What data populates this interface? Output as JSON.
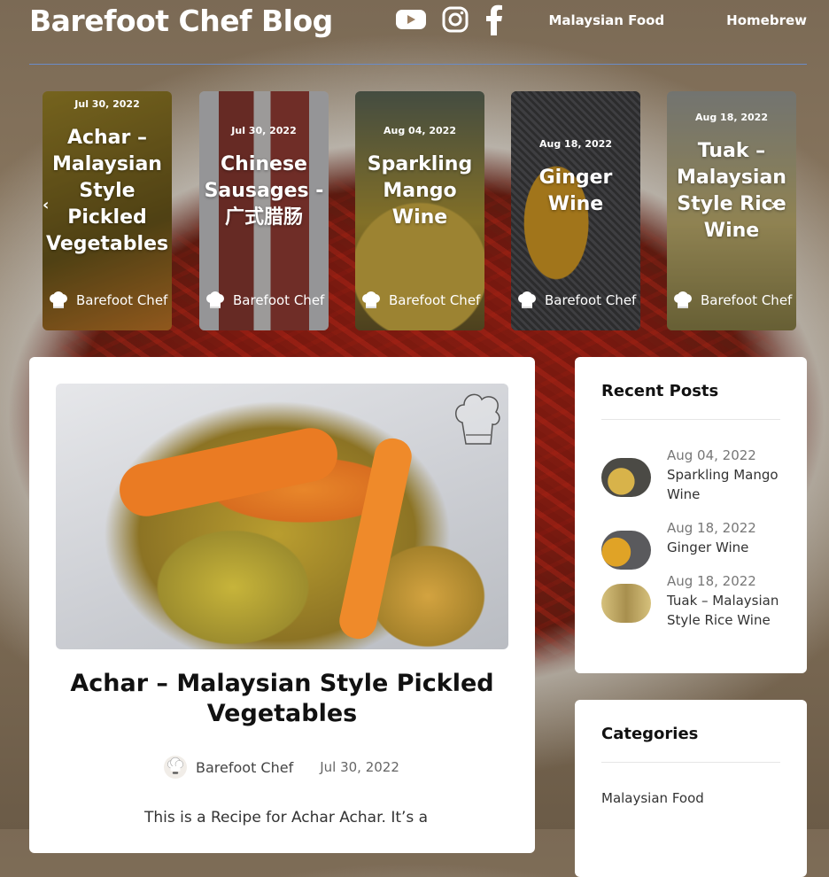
{
  "site": {
    "title": "Barefoot Chef Blog"
  },
  "social": [
    "youtube-icon",
    "instagram-icon",
    "facebook-icon"
  ],
  "nav": [
    "Malaysian Food",
    "Homebrew"
  ],
  "carousel": [
    {
      "date": "Jul 30, 2022",
      "title": "Achar – Malaysian Style Pickled Vegetables",
      "author": "Barefoot Chef",
      "color": "#8a7a2a"
    },
    {
      "date": "Jul 30, 2022",
      "title": "Chinese Sausages - 广式腊肠",
      "author": "Barefoot Chef",
      "color": "#9b5a4a"
    },
    {
      "date": "Aug 04, 2022",
      "title": "Sparkling Mango Wine",
      "author": "Barefoot Chef",
      "color": "#b49a3e"
    },
    {
      "date": "Aug 18, 2022",
      "title": "Ginger Wine",
      "author": "Barefoot Chef",
      "color": "#6f6a5c"
    },
    {
      "date": "Aug 18, 2022",
      "title": "Tuak – Malaysian Style Rice Wine",
      "author": "Barefoot Chef",
      "color": "#a39a62"
    }
  ],
  "post": {
    "title": "Achar – Malaysian Style Pickled Vegetables",
    "author": "Barefoot Chef",
    "date": "Jul 30, 2022",
    "excerpt": "This is a Recipe for Achar Achar. It’s a"
  },
  "recent": {
    "title": "Recent Posts",
    "items": [
      {
        "date": "Aug 04, 2022",
        "name": "Sparkling Mango Wine",
        "color": "#c9a13a"
      },
      {
        "date": "Aug 18, 2022",
        "name": "Ginger Wine",
        "color": "#c98d24"
      },
      {
        "date": "Aug 18, 2022",
        "name": "Tuak – Malaysian Style Rice Wine",
        "color": "#b99a52"
      }
    ]
  },
  "categories": {
    "title": "Categories",
    "items": [
      "Malaysian Food"
    ]
  }
}
